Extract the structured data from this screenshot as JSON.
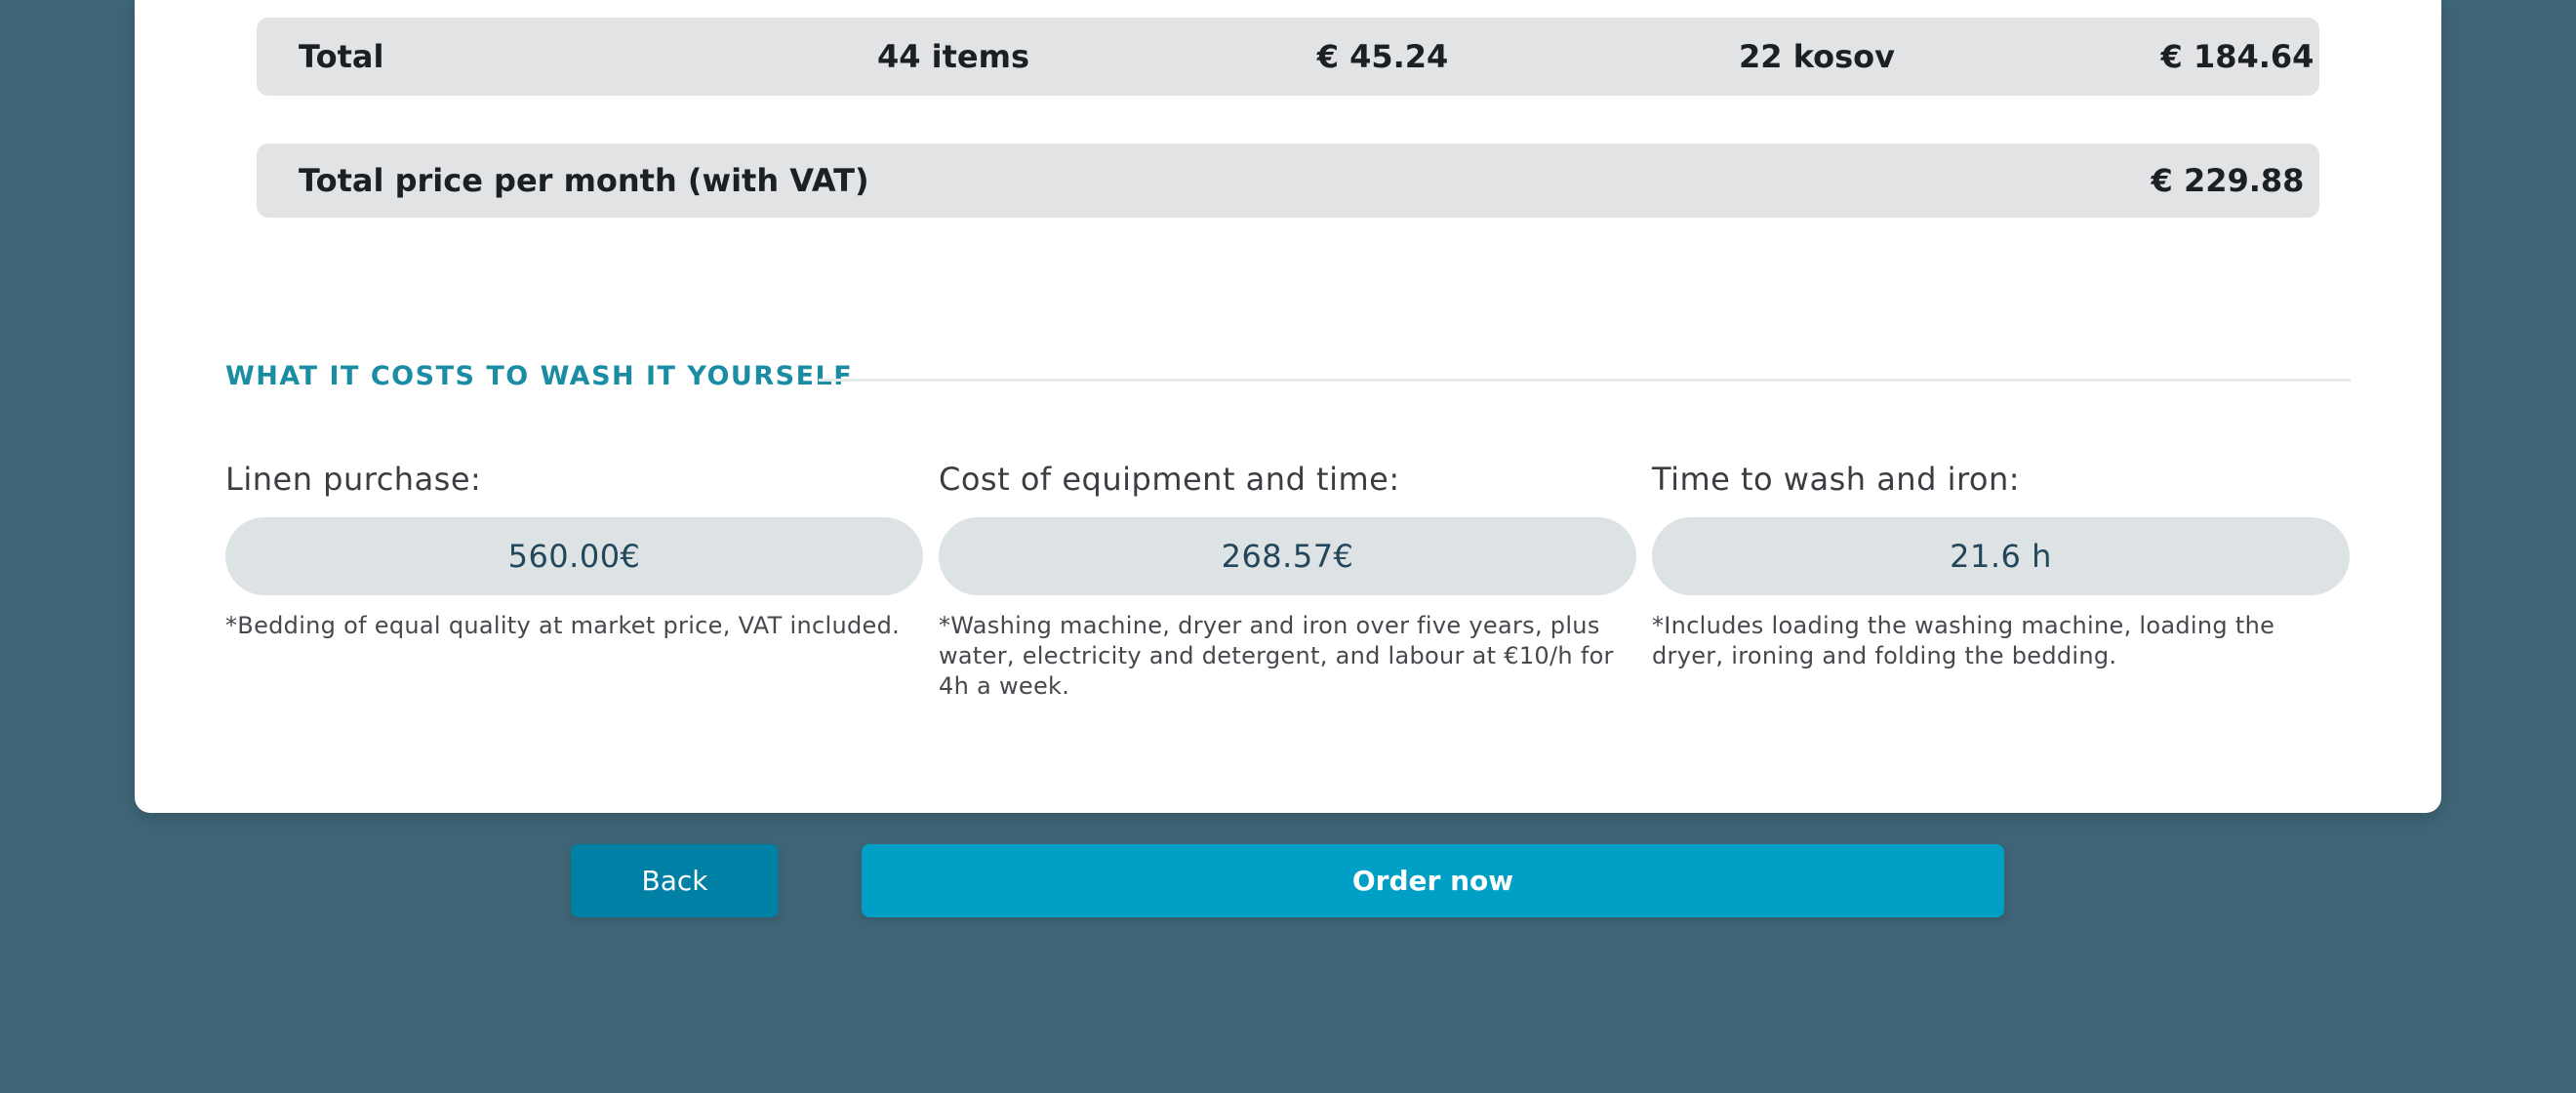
{
  "totals_row": {
    "label": "Total",
    "items": "44 items",
    "price": "€  45.24",
    "kosov": "22 kosov",
    "price2": "€  184.64"
  },
  "monthly_row": {
    "label": "Total price per month (with VAT)",
    "price": "€  229.88"
  },
  "diy_section": {
    "heading": "WHAT IT COSTS TO WASH IT YOURSELF",
    "columns": [
      {
        "label": "Linen purchase:",
        "value": "560.00€",
        "note": "*Bedding of equal quality at market price, VAT included."
      },
      {
        "label": "Cost of equipment and time:",
        "value": "268.57€",
        "note": "*Washing machine, dryer and iron over five years, plus water, electricity and detergent, and labour at €10/h for 4h a week."
      },
      {
        "label": "Time to wash and iron:",
        "value": "21.6 h",
        "note": "*Includes loading the washing machine, loading the dryer, ironing and folding the bedding."
      }
    ]
  },
  "actions": {
    "back_label": "Back",
    "order_label": "Order now"
  },
  "colors": {
    "background": "#3e6475",
    "accent": "#1a8ca3",
    "primary_button": "#00a0c6",
    "secondary_button": "#0080a5"
  }
}
